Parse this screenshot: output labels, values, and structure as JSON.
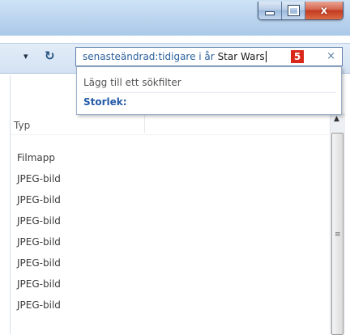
{
  "window": {
    "close_label": "x"
  },
  "toolbar": {
    "history_dropdown": "▾",
    "refresh_icon": "↻"
  },
  "search": {
    "query_keyword": "senasteändrad:tidigare i år",
    "query_term": "Star Wars",
    "step_badge": "5",
    "clear_label": "×"
  },
  "suggestions": {
    "hint": "Lägg till ett sökfilter",
    "items": [
      "Storlek:"
    ]
  },
  "file_list": {
    "column_header": "Typ",
    "items": [
      "Filmapp",
      "JPEG-bild",
      "JPEG-bild",
      "JPEG-bild",
      "JPEG-bild",
      "JPEG-bild",
      "JPEG-bild",
      "JPEG-bild"
    ]
  }
}
